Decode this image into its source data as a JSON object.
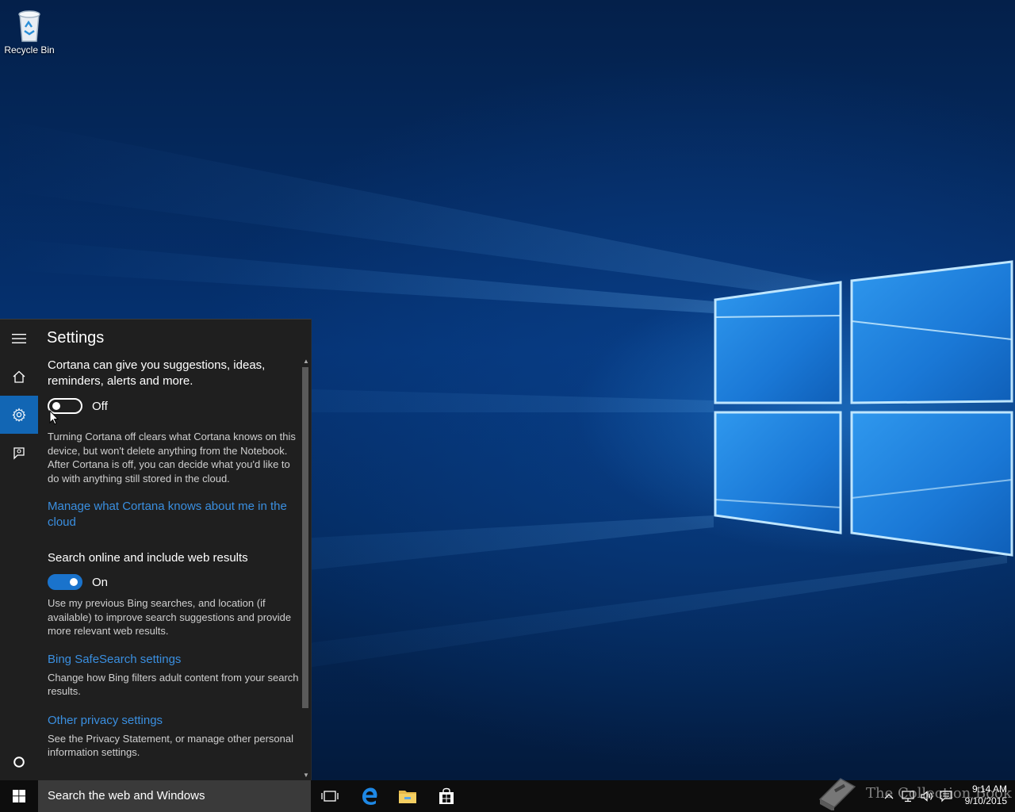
{
  "desktop": {
    "icons": [
      {
        "label": "Recycle Bin",
        "icon": "recycle-bin-icon"
      }
    ]
  },
  "cortana": {
    "rail": [
      {
        "name": "menu",
        "icon": "hamburger-menu-icon"
      },
      {
        "name": "home",
        "icon": "home-icon"
      },
      {
        "name": "settings",
        "icon": "gear-icon",
        "active": true
      },
      {
        "name": "feedback",
        "icon": "feedback-icon"
      },
      {
        "name": "cortana",
        "icon": "cortana-circle-icon"
      }
    ],
    "title": "Settings",
    "sections": {
      "cortana_intro": "Cortana can give you suggestions, ideas, reminders, alerts and more.",
      "cortana_toggle": {
        "state": "off",
        "label": "Off"
      },
      "cortana_desc": "Turning Cortana off clears what Cortana knows on this device, but won't delete anything from the Notebook. After Cortana is off, you can decide what you'd like to do with anything still stored in the cloud.",
      "manage_link": "Manage what Cortana knows about me in the cloud",
      "search_online_title": "Search online and include web results",
      "search_online_toggle": {
        "state": "on",
        "label": "On"
      },
      "search_online_desc": "Use my previous Bing searches, and location (if available) to improve search suggestions and provide more relevant web results.",
      "safesearch_link": "Bing SafeSearch settings",
      "safesearch_desc": "Change how Bing filters adult content from your search results.",
      "privacy_link": "Other privacy settings",
      "privacy_desc": "See the Privacy Statement, or manage other personal information settings."
    },
    "colors": {
      "accent": "#1266b4",
      "link": "#3a8fe0",
      "panel_bg": "#1f1f1f"
    }
  },
  "taskbar": {
    "start_icon": "windows-logo-icon",
    "search_placeholder": "Search the web and Windows",
    "pinned": [
      {
        "name": "task-view",
        "icon": "task-view-icon"
      },
      {
        "name": "edge",
        "icon": "edge-icon"
      },
      {
        "name": "file-explorer",
        "icon": "folder-icon"
      },
      {
        "name": "store",
        "icon": "store-icon"
      }
    ],
    "tray": [
      {
        "name": "show-hidden",
        "icon": "chevron-up-icon"
      },
      {
        "name": "network",
        "icon": "network-icon"
      },
      {
        "name": "volume",
        "icon": "volume-icon"
      },
      {
        "name": "action-center",
        "icon": "action-center-icon"
      }
    ],
    "clock": {
      "time": "9:14 AM",
      "date": "9/10/2015"
    }
  },
  "watermark": {
    "text": "The Collection Book"
  }
}
